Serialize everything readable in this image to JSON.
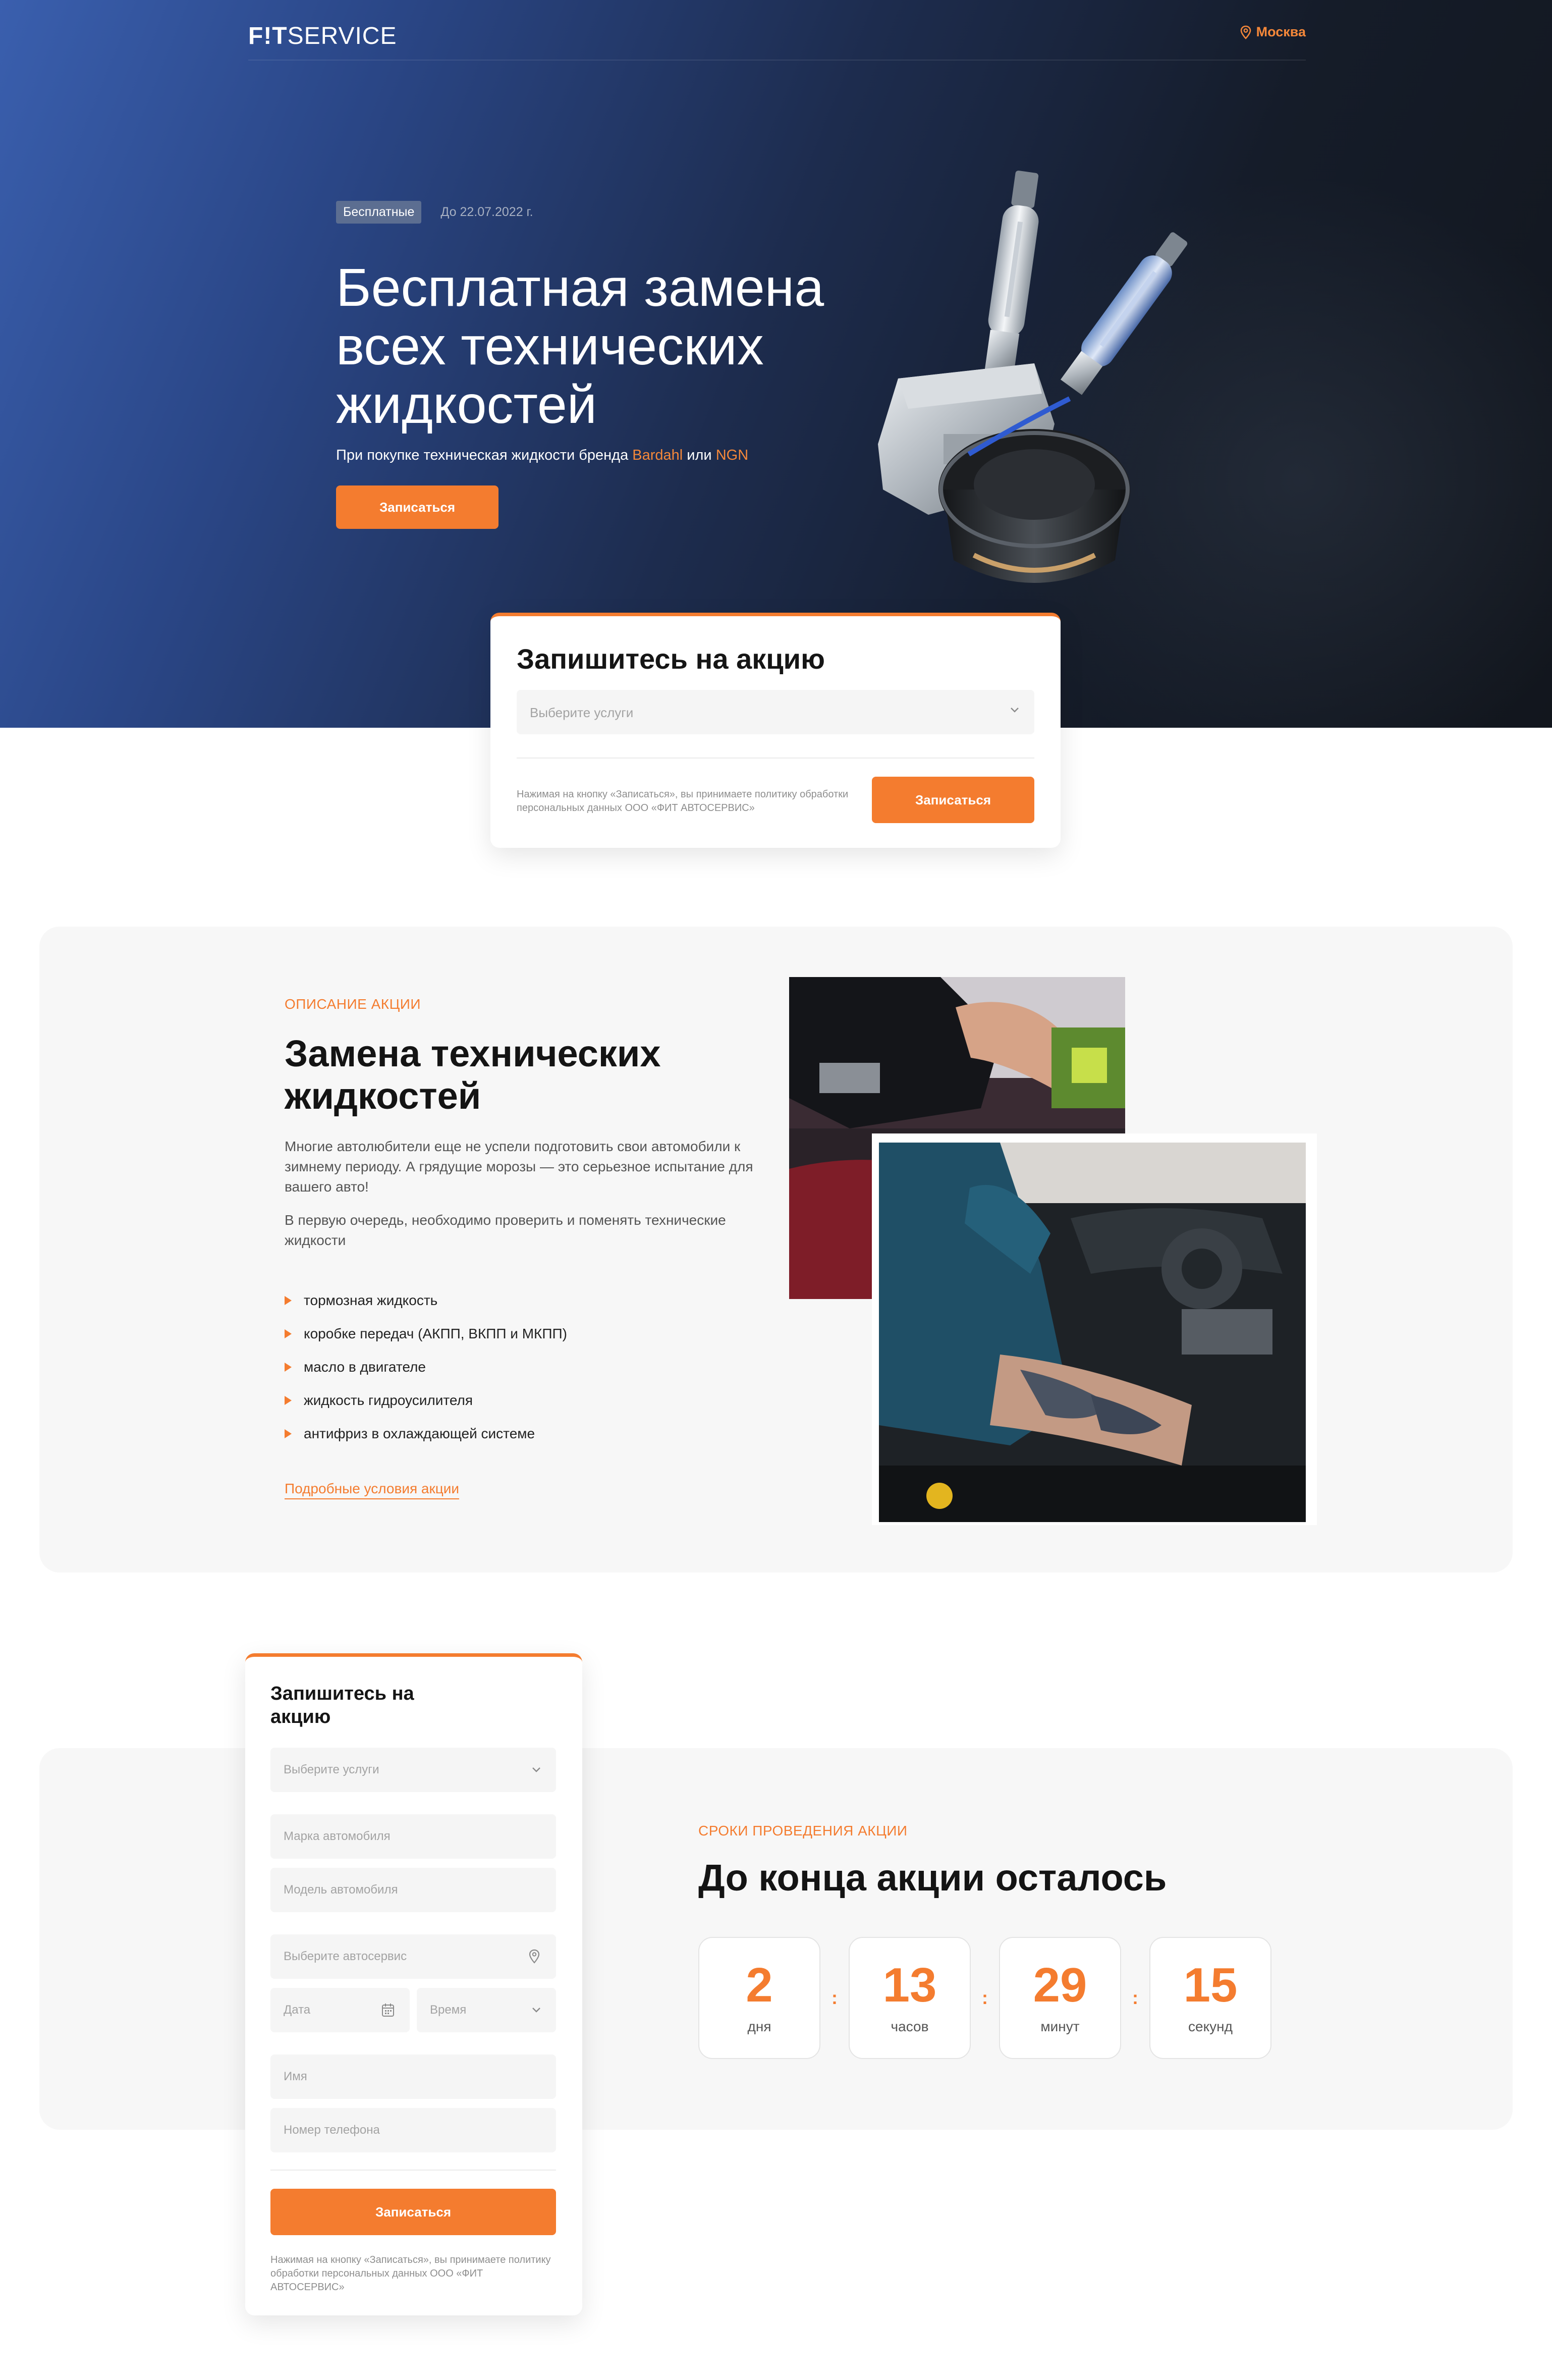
{
  "brand": {
    "logo_fit": "F!T",
    "logo_service": "SERVICE"
  },
  "header": {
    "city": "Москва"
  },
  "hero": {
    "badge": "Бесплатные",
    "date": "До 22.07.2022 г.",
    "title": "Бесплатная замена всех технических жидкостей",
    "subtitle_prefix": "При покупке техническая жидкости бренда ",
    "brand1": "Bardahl",
    "subtitle_mid": " или ",
    "brand2": "NGN",
    "button": "Записаться"
  },
  "signup_card": {
    "title": "Запишитесь на акцию",
    "service_placeholder": "Выберите услуги",
    "note": "Нажимая на кнопку «Записаться», вы принимаете политику обработки персональных данных ООО «ФИТ АВТОСЕРВИС»",
    "button": "Записаться"
  },
  "description": {
    "eyebrow": "ОПИСАНИЕ АКЦИИ",
    "title": "Замена технических жидкостей",
    "p1": "Многие автолюбители еще не успели подготовить свои автомобили к зимнему периоду. А грядущие морозы — это серьезное испытание для вашего авто!",
    "p2": "В первую очередь, необходимо проверить и поменять технические жидкости",
    "items": [
      "тормозная жидкость",
      "коробке передач (АКПП, ВКПП и МКПП)",
      "масло в двигателе",
      "жидкость гидроусилителя",
      "антифриз в охлаждающей системе"
    ],
    "link": "Подробные условия акции"
  },
  "countdown": {
    "eyebrow": "СРОКИ ПРОВЕДЕНИЯ АКЦИИ",
    "title": "До конца акции осталось",
    "units": [
      {
        "value": "2",
        "label": "дня"
      },
      {
        "value": "13",
        "label": "часов"
      },
      {
        "value": "29",
        "label": "минут"
      },
      {
        "value": "15",
        "label": "секунд"
      }
    ],
    "separator": ":"
  },
  "side_form": {
    "title": "Запишитесь на акцию",
    "service_placeholder": "Выберите услуги",
    "brand_placeholder": "Марка автомобиля",
    "model_placeholder": "Модель автомобиля",
    "station_placeholder": "Выберите автосервис",
    "date_placeholder": "Дата",
    "time_placeholder": "Время",
    "name_placeholder": "Имя",
    "phone_placeholder": "Номер телефона",
    "button": "Записаться",
    "note": "Нажимая на кнопку «Записаться», вы принимаете политику обработки персональных данных ООО «ФИТ АВТОСЕРВИС»"
  },
  "colors": {
    "accent": "#f47c2f",
    "hero_dark": "#12161d",
    "hero_blue": "#3a5fae",
    "section_bg": "#f7f7f7"
  },
  "icons": [
    "location-pin-icon",
    "chevron-down-icon",
    "calendar-icon",
    "bullet-arrow-icon"
  ]
}
